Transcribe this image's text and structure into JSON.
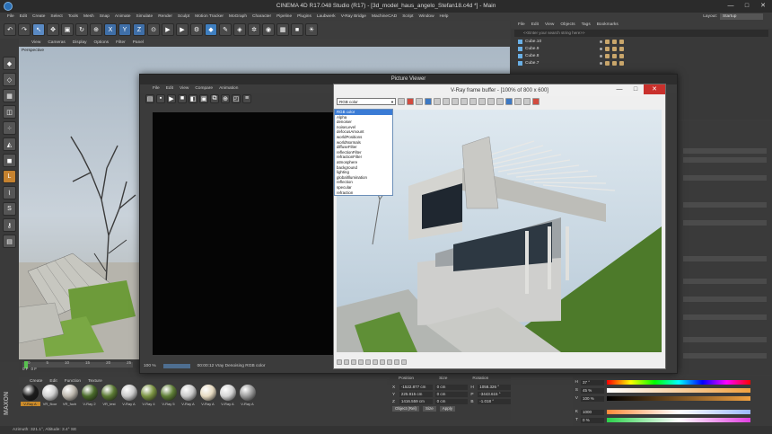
{
  "window": {
    "title": "CINEMA 4D R17.048 Studio (R17) - [3d_model_haus_angelo_Stefan18.c4d *] - Main",
    "min": "—",
    "max": "□",
    "close": "✕"
  },
  "menubar": [
    "File",
    "Edit",
    "Create",
    "Select",
    "Tools",
    "Mesh",
    "Snap",
    "Animate",
    "Simulate",
    "Render",
    "Sculpt",
    "Motion Tracker",
    "MoGraph",
    "Character",
    "Pipeline",
    "Plugins",
    "Laubwerk",
    "V-Ray Bridge",
    "MachineCAD",
    "Script",
    "Window",
    "Help"
  ],
  "layout": {
    "label": "Layout:",
    "value": "Startup"
  },
  "viewport": {
    "menu": [
      "View",
      "Cameras",
      "Display",
      "Options",
      "Filter",
      "Panel"
    ],
    "label": "Perspective"
  },
  "timeline": {
    "ticks": [
      "0",
      "5",
      "10",
      "15",
      "20",
      "25"
    ],
    "frame_field": "0 F",
    "frame_field2": "0 F"
  },
  "material_manager": {
    "menu": [
      "Create",
      "Edit",
      "Function",
      "Texture"
    ],
    "items": [
      {
        "label": "V-Ray A",
        "color": "#1c1c1c",
        "active": true
      },
      {
        "label": "VR_floor",
        "color": "#cfcfcf"
      },
      {
        "label": "VR_fuch",
        "color": "#bdb7ad"
      },
      {
        "label": "V-Ray 2",
        "color": "#4a6b2a"
      },
      {
        "label": "VR_test",
        "color": "#5b7a33"
      },
      {
        "label": "V-Ray A",
        "color": "#c9c9c9"
      },
      {
        "label": "V-Ray 4",
        "color": "#7b9442"
      },
      {
        "label": "V-Ray 5",
        "color": "#5f7f36"
      },
      {
        "label": "V-Ray A",
        "color": "#c9c9c9"
      },
      {
        "label": "V-Ray A",
        "color": "#e6dac1"
      },
      {
        "label": "V-Ray A",
        "color": "#d4d4d4"
      },
      {
        "label": "V-Ray A",
        "color": "#9a9a9a"
      }
    ],
    "brand": "MAXON"
  },
  "coordinates": {
    "headers": [
      "Position",
      "Size",
      "Rotation"
    ],
    "rows": [
      {
        "axis": "X",
        "pos": "-1522.877 cm",
        "size": "0 cm",
        "rot_axis": "H",
        "rot": "1058.326 °"
      },
      {
        "axis": "Y",
        "pos": "225.915 cm",
        "size": "0 cm",
        "rot_axis": "P",
        "rot": "-3443.615 °"
      },
      {
        "axis": "Z",
        "pos": "1416.559 cm",
        "size": "0 cm",
        "rot_axis": "B",
        "rot": "-1.018 °"
      }
    ],
    "mode": "Object (Rel)",
    "size_mode": "Size",
    "apply": "Apply"
  },
  "status_bar": "Azimuth: 321.1°, Altitude: 3.4° SE",
  "object_manager": {
    "menu": [
      "File",
      "Edit",
      "View",
      "Objects",
      "Tags",
      "Bookmarks"
    ],
    "search_placeholder": "<<Enter your search string here>>",
    "objects": [
      "Cube.10",
      "Cube.9",
      "Cube.8",
      "Cube.7"
    ]
  },
  "color_panel": {
    "rows": [
      {
        "key": "H",
        "value": "37 °"
      },
      {
        "key": "S",
        "value": "45 %"
      },
      {
        "key": "V",
        "value": "100 %"
      },
      {
        "key": "",
        "value": ""
      },
      {
        "key": "K",
        "value": "1000"
      },
      {
        "key": "T",
        "value": "0 %"
      }
    ]
  },
  "picture_viewer": {
    "title": "Picture Viewer",
    "menu": [
      "File",
      "Edit",
      "View",
      "Compare",
      "Animation"
    ],
    "zoom": "100 %",
    "status": "00:00:12 Vray Denoising RGB color"
  },
  "vfb": {
    "title": "V-Ray frame buffer - [100% of 800 x 600]",
    "channel_selected": "RGB color",
    "channels": [
      "RGB color",
      "Alpha",
      "denoiser",
      "noiseLevel",
      "defocusAmount",
      "worldPositions",
      "worldNormals",
      "diffuseFilter",
      "reflectionFilter",
      "refractionFilter",
      "atmosphere",
      "background",
      "lighting",
      "globalIllumination",
      "reflection",
      "specular",
      "refraction"
    ]
  }
}
